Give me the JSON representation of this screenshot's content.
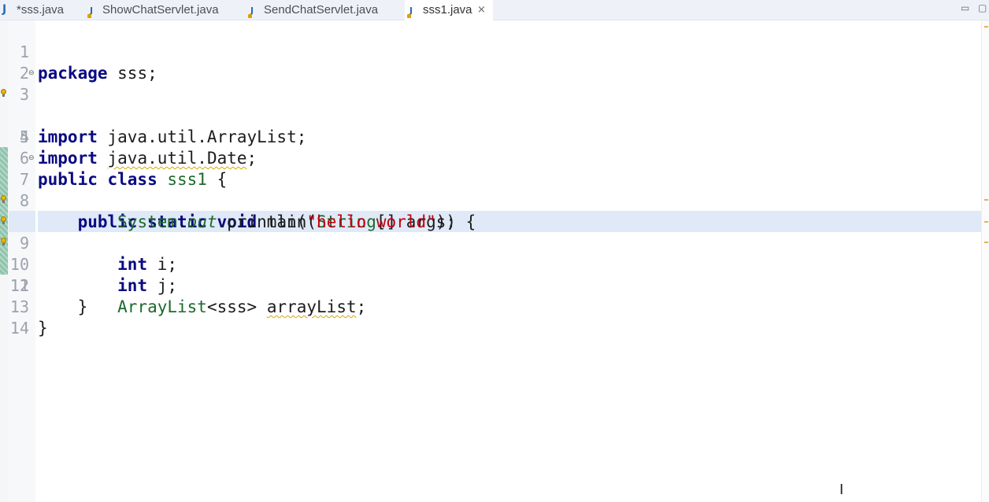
{
  "tabs": [
    {
      "label": "*sss.java",
      "active": false
    },
    {
      "label": "ShowChatServlet.java",
      "active": false
    },
    {
      "label": "SendChatServlet.java",
      "active": false
    },
    {
      "label": "sss1.java",
      "active": true
    }
  ],
  "close_glyph": "×",
  "window_controls": {
    "minimize": "▭",
    "maximize": "▢"
  },
  "line_numbers": [
    "1",
    "2",
    "3",
    "4",
    "5",
    "6",
    "7",
    "8",
    "9",
    "10",
    "11",
    "12",
    "13",
    "14"
  ],
  "code": {
    "l1_kw": "package",
    "l1_rest": " sss;",
    "l3_kw": "import",
    "l3_rest": " java.util.ArrayList;",
    "l4_kw": "import",
    "l4_pre": " ",
    "l4_sq": "java.util.Date",
    "l4_post": ";",
    "l6_kw": "public class",
    "l6_sp": " ",
    "l6_name": "sss1",
    "l6_rest": " {",
    "l7_indent": "    ",
    "l7_kw": "public static void",
    "l7_rest1": " main(",
    "l7_ty": "String",
    "l7_rest2": "[] args) {",
    "l8_indent": "        ",
    "l8_ty": "System",
    "l8_rest1": ".",
    "l8_out": "out",
    "l8_rest2": ".println(",
    "l8_str": "\"hello world\"",
    "l8_rest3": ");",
    "l9_indent": "        ",
    "l9_kw": "int",
    "l9_rest": " i;",
    "l10_indent": "        ",
    "l10_kw": "int",
    "l10_rest": " j;",
    "l11_indent": "        ",
    "l11_ty": "ArrayList",
    "l11_rest1": "<sss> ",
    "l11_sq": "arrayList",
    "l11_rest2": ";",
    "l12": "    }",
    "l13": "}"
  },
  "colors": {
    "keyword": "#0a0a82",
    "type": "#1d6a2b",
    "string": "#c0000f",
    "current_line": "#dfe9f7",
    "warning": "#e6b800"
  },
  "icons": {
    "java_file": "J",
    "text_cursor": "I"
  }
}
